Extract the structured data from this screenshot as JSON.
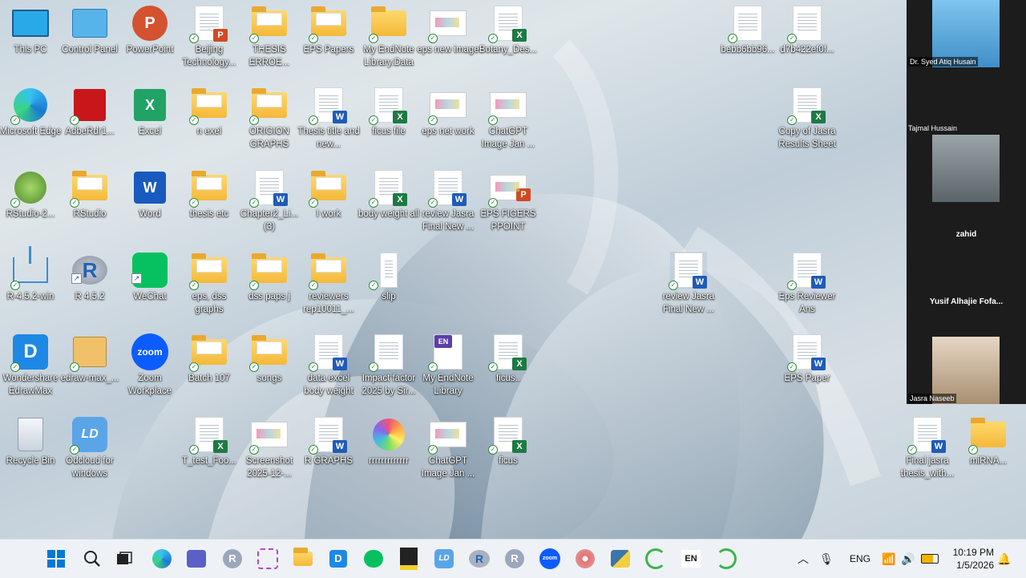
{
  "desktop_icons": [
    {
      "label": "This PC"
    },
    {
      "label": "Control Panel"
    },
    {
      "label": "PowerPoint"
    },
    {
      "label": "Beijing Technology..."
    },
    {
      "label": "THESIS ERROE..."
    },
    {
      "label": "EPS Papers"
    },
    {
      "label": "My EndNote Library.Data"
    },
    {
      "label": "eps new image"
    },
    {
      "label": "Botany_Des..."
    },
    {
      "label": "bebb6bb96..."
    },
    {
      "label": "d7b422ef0f..."
    },
    {
      "label": "Microsoft Edge"
    },
    {
      "label": "AdbeRdr1..."
    },
    {
      "label": "Excel"
    },
    {
      "label": "n exel"
    },
    {
      "label": "ORIGION GRAPHS"
    },
    {
      "label": "Thesis title and new..."
    },
    {
      "label": "ficus file"
    },
    {
      "label": "eps net work"
    },
    {
      "label": "ChatGPT Image Jan ..."
    },
    {
      "label": "Copy of Jasra Results Sheet"
    },
    {
      "label": "RStudio-2..."
    },
    {
      "label": "RStudio"
    },
    {
      "label": "Word"
    },
    {
      "label": "thesis etc"
    },
    {
      "label": "Chapter2_Li... (3)"
    },
    {
      "label": "I work"
    },
    {
      "label": "body weight all"
    },
    {
      "label": "review Jasra Final New ..."
    },
    {
      "label": "EPS FIGERS PPOINT"
    },
    {
      "label": "R-4.5.2-win"
    },
    {
      "label": "R 4.5.2"
    },
    {
      "label": "WeChat"
    },
    {
      "label": "eps, dss graphs"
    },
    {
      "label": "dss paps j"
    },
    {
      "label": "reviewers rep10011_..."
    },
    {
      "label": "slip"
    },
    {
      "label": "review Jasra Final New ..."
    },
    {
      "label": "Eps Reviewer Ans"
    },
    {
      "label": "Wondershare EdrawMax"
    },
    {
      "label": "edraw-max_..."
    },
    {
      "label": "Zoom Workplace"
    },
    {
      "label": "Batch 107"
    },
    {
      "label": "songs"
    },
    {
      "label": "data excel body weight"
    },
    {
      "label": "Impact factor 2025 by Sir..."
    },
    {
      "label": "My EndNote Library"
    },
    {
      "label": "ficus.."
    },
    {
      "label": "EPS Paper"
    },
    {
      "label": "Recycle Bin"
    },
    {
      "label": "Odcloud for windows"
    },
    {
      "label": "T_test_Foo..."
    },
    {
      "label": "Screenshot 2025-12-..."
    },
    {
      "label": "R GRAPHS"
    },
    {
      "label": "rrrrrrrrrrrrr"
    },
    {
      "label": "ChatGPT Image Jan ..."
    },
    {
      "label": "ficus"
    },
    {
      "label": "Final jasra thesis_with..."
    },
    {
      "label": "miRNA..."
    }
  ],
  "icon_glyphs": {
    "ppt_letter": "P",
    "excel_letter": "X",
    "word_letter": "W",
    "r_letter": "R",
    "zoom_text": "zoom",
    "endnote_badge": "EN",
    "edraw_letter": "D",
    "dd_letters": "LD"
  },
  "participants": [
    {
      "name": "Dr. Syed Atiq Husain"
    },
    {
      "name": "Tajmal Hussain"
    },
    {
      "name": "zahid"
    },
    {
      "name": "Yusif Alhajie Fofa..."
    },
    {
      "name": "Jasra Naseeb"
    }
  ],
  "taskbar": {
    "tray_language": "ENG",
    "clock_time": "10:19 PM",
    "clock_date": "1/5/2026",
    "en_label": "EN"
  },
  "colors": {
    "accent": "#0078d4",
    "taskbar_bg": "#eef2f6"
  }
}
